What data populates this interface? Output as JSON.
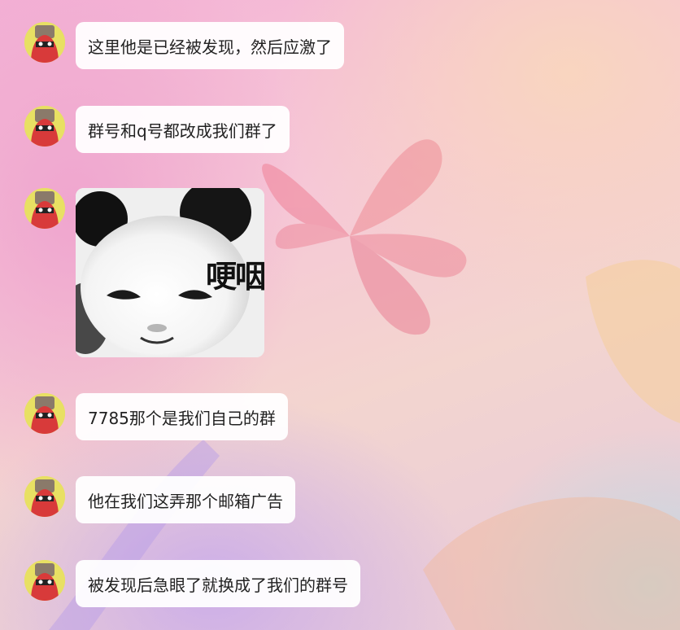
{
  "messages": [
    {
      "type": "text",
      "text": "这里他是已经被发现，然后应激了"
    },
    {
      "type": "text",
      "text": "群号和q号都改成我们群了"
    },
    {
      "type": "image",
      "caption": "哽咽",
      "icon": "panda-meme-sticker"
    },
    {
      "type": "text",
      "text": "7785那个是我们自己的群"
    },
    {
      "type": "text",
      "text": "他在我们这弄那个邮箱广告"
    },
    {
      "type": "text",
      "text": "被发现后急眼了就换成了我们的群号"
    }
  ],
  "colors": {
    "bubble": "#ffffff",
    "text": "#222222",
    "avatar_bg": "#e8e063",
    "avatar_figure": "#d83a3a"
  }
}
